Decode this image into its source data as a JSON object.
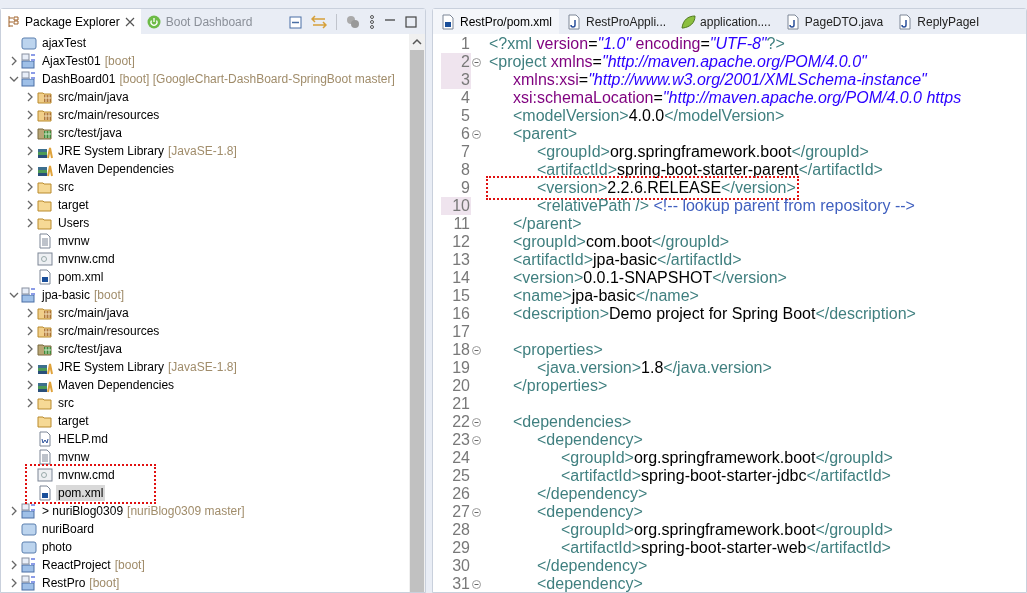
{
  "explorer": {
    "tabs": [
      {
        "label": "Package Explorer",
        "selected": true
      },
      {
        "label": "Boot Dashboard",
        "selected": false
      }
    ],
    "tree": [
      {
        "label": "ajaxTest",
        "kind": "project",
        "selected": false
      },
      {
        "label": "AjaxTest01",
        "decoration": "[boot]",
        "kind": "boot-project",
        "expanded": false,
        "selected": false
      },
      {
        "label": "DashBoard01",
        "decoration": "[boot] [GoogleChart-DashBoard-SpringBoot master]",
        "kind": "boot-project",
        "expanded": true,
        "selected": false,
        "children": [
          {
            "label": "src/main/java",
            "kind": "source-folder",
            "expanded": false,
            "selected": false
          },
          {
            "label": "src/main/resources",
            "kind": "source-folder",
            "expanded": false,
            "selected": false
          },
          {
            "label": "src/test/java",
            "kind": "test-folder",
            "expanded": false,
            "selected": false
          },
          {
            "label": "JRE System Library",
            "decoration": "[JavaSE-1.8]",
            "kind": "library",
            "expanded": false,
            "selected": false
          },
          {
            "label": "Maven Dependencies",
            "kind": "library",
            "expanded": false,
            "selected": false
          },
          {
            "label": "src",
            "kind": "folder",
            "expanded": false,
            "selected": false
          },
          {
            "label": "target",
            "kind": "folder",
            "expanded": false,
            "selected": false
          },
          {
            "label": "Users",
            "kind": "folder",
            "expanded": false,
            "selected": false
          },
          {
            "label": "mvnw",
            "kind": "file",
            "selected": false
          },
          {
            "label": "mvnw.cmd",
            "kind": "cmd-file",
            "selected": false
          },
          {
            "label": "pom.xml",
            "kind": "pom-file",
            "selected": false
          }
        ]
      },
      {
        "label": "jpa-basic",
        "decoration": "[boot]",
        "kind": "boot-project",
        "expanded": true,
        "selected": false,
        "children": [
          {
            "label": "src/main/java",
            "kind": "source-folder",
            "expanded": false,
            "selected": false
          },
          {
            "label": "src/main/resources",
            "kind": "source-folder",
            "expanded": false,
            "selected": false
          },
          {
            "label": "src/test/java",
            "kind": "test-folder",
            "expanded": false,
            "selected": false
          },
          {
            "label": "JRE System Library",
            "decoration": "[JavaSE-1.8]",
            "kind": "library",
            "expanded": false,
            "selected": false
          },
          {
            "label": "Maven Dependencies",
            "kind": "library",
            "expanded": false,
            "selected": false
          },
          {
            "label": "src",
            "kind": "folder",
            "expanded": false,
            "selected": false
          },
          {
            "label": "target",
            "kind": "folder",
            "selected": false
          },
          {
            "label": "HELP.md",
            "kind": "md-file",
            "selected": false
          },
          {
            "label": "mvnw",
            "kind": "file",
            "selected": false
          },
          {
            "label": "mvnw.cmd",
            "kind": "cmd-file",
            "selected": false
          },
          {
            "label": "pom.xml",
            "kind": "pom-file",
            "selected": true
          }
        ]
      },
      {
        "label": "> nuriBlog0309",
        "decoration": "[nuriBlog0309 master]",
        "kind": "boot-project",
        "expanded": false,
        "selected": false
      },
      {
        "label": "nuriBoard",
        "kind": "project",
        "selected": false
      },
      {
        "label": "photo",
        "kind": "project",
        "selected": false
      },
      {
        "label": "ReactProject",
        "decoration": "[boot]",
        "kind": "boot-project",
        "expanded": false,
        "selected": false
      },
      {
        "label": "RestPro",
        "decoration": "[boot]",
        "kind": "boot-project",
        "expanded": false,
        "selected": false
      }
    ]
  },
  "editor": {
    "tabs": [
      {
        "label": "RestPro/pom.xml",
        "kind": "pom-file",
        "selected": true
      },
      {
        "label": "RestProAppli...",
        "kind": "java-file",
        "selected": false
      },
      {
        "label": "application....",
        "kind": "leaf",
        "selected": false
      },
      {
        "label": "PageDTO.java",
        "kind": "java-file",
        "selected": false
      },
      {
        "label": "ReplyPageI",
        "kind": "java-file",
        "selected": false
      }
    ],
    "lines": [
      {
        "number": "1",
        "highlighted": false,
        "foldable": false,
        "tokens": [
          {
            "kind": "tag",
            "text": "<?xml"
          },
          {
            "kind": "attr",
            "text": " version"
          },
          {
            "kind": "punct",
            "text": "="
          },
          {
            "kind": "value",
            "text": "\"1.0\""
          },
          {
            "kind": "attr",
            "text": " encoding"
          },
          {
            "kind": "punct",
            "text": "="
          },
          {
            "kind": "value",
            "text": "\"UTF-8\""
          },
          {
            "kind": "tag",
            "text": "?>"
          }
        ]
      },
      {
        "number": "2",
        "highlighted": true,
        "foldable": true,
        "tokens": [
          {
            "kind": "tag",
            "text": "<project"
          },
          {
            "kind": "attr",
            "text": " xmlns"
          },
          {
            "kind": "punct",
            "text": "="
          },
          {
            "kind": "value",
            "text": "\"http://maven.apache.org/POM/4.0.0\""
          }
        ]
      },
      {
        "number": "3",
        "highlighted": true,
        "foldable": false,
        "tokens": [
          {
            "kind": "attr",
            "text": "\txmlns:xsi"
          },
          {
            "kind": "punct",
            "text": "="
          },
          {
            "kind": "value",
            "text": "\"http://www.w3.org/2001/XMLSchema-instance\""
          }
        ]
      },
      {
        "number": "4",
        "highlighted": false,
        "foldable": false,
        "tokens": [
          {
            "kind": "attr",
            "text": "\txsi:schemaLocation"
          },
          {
            "kind": "punct",
            "text": "="
          },
          {
            "kind": "value",
            "text": "\"http://maven.apache.org/POM/4.0.0 https"
          }
        ]
      },
      {
        "number": "5",
        "highlighted": false,
        "foldable": false,
        "tokens": [
          {
            "kind": "tag",
            "text": "\t<modelVersion>"
          },
          {
            "kind": "text",
            "text": "4.0.0"
          },
          {
            "kind": "tag",
            "text": "</modelVersion>"
          }
        ]
      },
      {
        "number": "6",
        "highlighted": false,
        "foldable": true,
        "tokens": [
          {
            "kind": "tag",
            "text": "\t<parent>"
          }
        ]
      },
      {
        "number": "7",
        "highlighted": false,
        "foldable": false,
        "tokens": [
          {
            "kind": "tag",
            "text": "\t\t<groupId>"
          },
          {
            "kind": "text",
            "text": "org.springframework.boot"
          },
          {
            "kind": "tag",
            "text": "</groupId>"
          }
        ]
      },
      {
        "number": "8",
        "highlighted": false,
        "foldable": false,
        "tokens": [
          {
            "kind": "tag",
            "text": "\t\t<artifactId>"
          },
          {
            "kind": "text",
            "text": "spring-boot-starter-parent"
          },
          {
            "kind": "tag",
            "text": "</artifactId>"
          }
        ]
      },
      {
        "number": "9",
        "highlighted": false,
        "foldable": false,
        "annotated": true,
        "tokens": [
          {
            "kind": "tag",
            "text": "\t\t<version>"
          },
          {
            "kind": "text",
            "text": "2.2.6.RELEASE"
          },
          {
            "kind": "tag",
            "text": "</version>"
          }
        ]
      },
      {
        "number": "10",
        "highlighted": true,
        "foldable": false,
        "tokens": [
          {
            "kind": "tag",
            "text": "\t\t<relativePath />"
          },
          {
            "kind": "comment",
            "text": " <!-- lookup parent from repository -->"
          }
        ]
      },
      {
        "number": "11",
        "highlighted": false,
        "foldable": false,
        "tokens": [
          {
            "kind": "tag",
            "text": "\t</parent>"
          }
        ]
      },
      {
        "number": "12",
        "highlighted": false,
        "foldable": false,
        "tokens": [
          {
            "kind": "tag",
            "text": "\t<groupId>"
          },
          {
            "kind": "text",
            "text": "com.boot"
          },
          {
            "kind": "tag",
            "text": "</groupId>"
          }
        ]
      },
      {
        "number": "13",
        "highlighted": false,
        "foldable": false,
        "tokens": [
          {
            "kind": "tag",
            "text": "\t<artifactId>"
          },
          {
            "kind": "text",
            "text": "jpa-basic"
          },
          {
            "kind": "tag",
            "text": "</artifactId>"
          }
        ]
      },
      {
        "number": "14",
        "highlighted": false,
        "foldable": false,
        "tokens": [
          {
            "kind": "tag",
            "text": "\t<version>"
          },
          {
            "kind": "text",
            "text": "0.0.1-SNAPSHOT"
          },
          {
            "kind": "tag",
            "text": "</version>"
          }
        ]
      },
      {
        "number": "15",
        "highlighted": false,
        "foldable": false,
        "tokens": [
          {
            "kind": "tag",
            "text": "\t<name>"
          },
          {
            "kind": "text",
            "text": "jpa-basic"
          },
          {
            "kind": "tag",
            "text": "</name>"
          }
        ]
      },
      {
        "number": "16",
        "highlighted": false,
        "foldable": false,
        "tokens": [
          {
            "kind": "tag",
            "text": "\t<description>"
          },
          {
            "kind": "text",
            "text": "Demo project for Spring Boot"
          },
          {
            "kind": "tag",
            "text": "</description>"
          }
        ]
      },
      {
        "number": "17",
        "highlighted": false,
        "foldable": false
      },
      {
        "number": "18",
        "highlighted": false,
        "foldable": true,
        "tokens": [
          {
            "kind": "tag",
            "text": "\t<properties>"
          }
        ]
      },
      {
        "number": "19",
        "highlighted": false,
        "foldable": false,
        "tokens": [
          {
            "kind": "tag",
            "text": "\t\t<java.version>"
          },
          {
            "kind": "text",
            "text": "1.8"
          },
          {
            "kind": "tag",
            "text": "</java.version>"
          }
        ]
      },
      {
        "number": "20",
        "highlighted": false,
        "foldable": false,
        "tokens": [
          {
            "kind": "tag",
            "text": "\t</properties>"
          }
        ]
      },
      {
        "number": "21",
        "highlighted": false,
        "foldable": false
      },
      {
        "number": "22",
        "highlighted": false,
        "foldable": true,
        "tokens": [
          {
            "kind": "tag",
            "text": "\t<dependencies>"
          }
        ]
      },
      {
        "number": "23",
        "highlighted": false,
        "foldable": true,
        "tokens": [
          {
            "kind": "tag",
            "text": "\t\t<dependency>"
          }
        ]
      },
      {
        "number": "24",
        "highlighted": false,
        "foldable": false,
        "tokens": [
          {
            "kind": "tag",
            "text": "\t\t\t<groupId>"
          },
          {
            "kind": "text",
            "text": "org.springframework.boot"
          },
          {
            "kind": "tag",
            "text": "</groupId>"
          }
        ]
      },
      {
        "number": "25",
        "highlighted": false,
        "foldable": false,
        "tokens": [
          {
            "kind": "tag",
            "text": "\t\t\t<artifactId>"
          },
          {
            "kind": "text",
            "text": "spring-boot-starter-jdbc"
          },
          {
            "kind": "tag",
            "text": "</artifactId>"
          }
        ]
      },
      {
        "number": "26",
        "highlighted": false,
        "foldable": false,
        "tokens": [
          {
            "kind": "tag",
            "text": "\t\t</dependency>"
          }
        ]
      },
      {
        "number": "27",
        "highlighted": false,
        "foldable": true,
        "tokens": [
          {
            "kind": "tag",
            "text": "\t\t<dependency>"
          }
        ]
      },
      {
        "number": "28",
        "highlighted": false,
        "foldable": false,
        "tokens": [
          {
            "kind": "tag",
            "text": "\t\t\t<groupId>"
          },
          {
            "kind": "text",
            "text": "org.springframework.boot"
          },
          {
            "kind": "tag",
            "text": "</groupId>"
          }
        ]
      },
      {
        "number": "29",
        "highlighted": false,
        "foldable": false,
        "tokens": [
          {
            "kind": "tag",
            "text": "\t\t\t<artifactId>"
          },
          {
            "kind": "text",
            "text": "spring-boot-starter-web"
          },
          {
            "kind": "tag",
            "text": "</artifactId>"
          }
        ]
      },
      {
        "number": "30",
        "highlighted": false,
        "foldable": false,
        "tokens": [
          {
            "kind": "tag",
            "text": "\t\t</dependency>"
          }
        ]
      },
      {
        "number": "31",
        "highlighted": false,
        "foldable": true,
        "tokens": [
          {
            "kind": "tag",
            "text": "\t\t<dependency>"
          }
        ]
      }
    ]
  }
}
